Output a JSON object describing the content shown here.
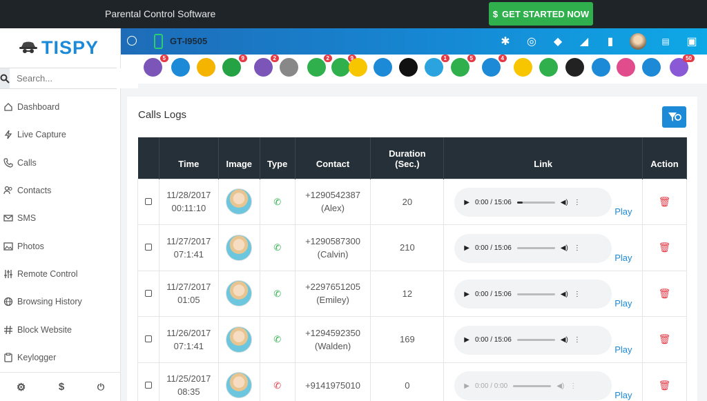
{
  "topbar": {
    "title": "Parental Control Software",
    "cta_label": "GET STARTED NOW",
    "cta_icon": "$"
  },
  "brand": {
    "name": "TISPY"
  },
  "search": {
    "placeholder": "Search..."
  },
  "nav": [
    {
      "label": "Dashboard",
      "icon": "home-icon"
    },
    {
      "label": "Live Capture",
      "icon": "bolt-icon"
    },
    {
      "label": "Calls",
      "icon": "phone-icon"
    },
    {
      "label": "Contacts",
      "icon": "users-icon"
    },
    {
      "label": "SMS",
      "icon": "mail-icon"
    },
    {
      "label": "Photos",
      "icon": "image-icon"
    },
    {
      "label": "Remote Control",
      "icon": "sliders-icon"
    },
    {
      "label": "Browsing History",
      "icon": "globe-icon"
    },
    {
      "label": "Block Website",
      "icon": "hash-icon"
    },
    {
      "label": "Keylogger",
      "icon": "clipboard-icon"
    }
  ],
  "footer_icons": {
    "settings": "⚙",
    "billing": "$",
    "power": "⏻"
  },
  "device": {
    "name": "GT-I9505"
  },
  "apps": [
    {
      "name": "viber",
      "color": "#7b55b8",
      "badge": "5"
    },
    {
      "name": "gmail",
      "color": "#1d8ad7",
      "badge": ""
    },
    {
      "name": "docs",
      "color": "#f4b400",
      "badge": ""
    },
    {
      "name": "whatsapp",
      "color": "#25a244",
      "badge": "9"
    },
    {
      "name": "viber2",
      "color": "#7b55b8",
      "badge": "2"
    },
    {
      "name": "clipboard",
      "color": "#888888",
      "badge": ""
    },
    {
      "name": "wechat",
      "color": "#2fb04d",
      "badge": "2"
    },
    {
      "name": "wechat2",
      "color": "#2fb04d",
      "badge": "9"
    },
    {
      "name": "snapchat",
      "color": "#f7c600",
      "badge": ""
    },
    {
      "name": "messenger",
      "color": "#1d8ad7",
      "badge": ""
    },
    {
      "name": "tiktok",
      "color": "#111111",
      "badge": ""
    },
    {
      "name": "telegram",
      "color": "#2aa3df",
      "badge": "1"
    },
    {
      "name": "line",
      "color": "#2fb04d",
      "badge": "5"
    },
    {
      "name": "skype",
      "color": "#1d8ad7",
      "badge": "4"
    },
    {
      "name": "kakao",
      "color": "#f7c600",
      "badge": ""
    },
    {
      "name": "hangouts",
      "color": "#2fb04d",
      "badge": ""
    },
    {
      "name": "kik",
      "color": "#222222",
      "badge": ""
    },
    {
      "name": "imo",
      "color": "#1d8ad7",
      "badge": ""
    },
    {
      "name": "video",
      "color": "#e04c8c",
      "badge": ""
    },
    {
      "name": "hike",
      "color": "#1d8ad7",
      "badge": ""
    },
    {
      "name": "chat",
      "color": "#8a5ad6",
      "badge": "50"
    }
  ],
  "card": {
    "title": "Calls Logs"
  },
  "table": {
    "headers": [
      "",
      "Time",
      "Image",
      "Type",
      "Contact",
      "Duration (Sec.)",
      "Link",
      "Action"
    ],
    "rows": [
      {
        "date": "11/28/2017",
        "time": "00:11:10",
        "type": "incoming",
        "number": "+1290542387",
        "name": "(Alex)",
        "duration": "20",
        "player": "0:00 / 15:06",
        "play": "Play"
      },
      {
        "date": "11/27/2017",
        "time": "07:1:41",
        "type": "incoming",
        "number": "+1290587300",
        "name": "(Calvin)",
        "duration": "210",
        "player": "0:00 / 15:06",
        "play": "Play"
      },
      {
        "date": "11/27/2017",
        "time": "01:05",
        "type": "incoming",
        "number": "+2297651205",
        "name": "(Emiley)",
        "duration": "12",
        "player": "0:00 / 15:06",
        "play": "Play"
      },
      {
        "date": "11/26/2017",
        "time": "07:1:41",
        "type": "incoming",
        "number": "+1294592350",
        "name": "(Walden)",
        "duration": "169",
        "player": "0:00 / 15:06",
        "play": "Play"
      },
      {
        "date": "11/25/2017",
        "time": "08:35",
        "type": "missed",
        "number": "+9141975010",
        "name": "",
        "duration": "0",
        "player": "0:00 / 0:00",
        "play": "Play"
      }
    ]
  }
}
